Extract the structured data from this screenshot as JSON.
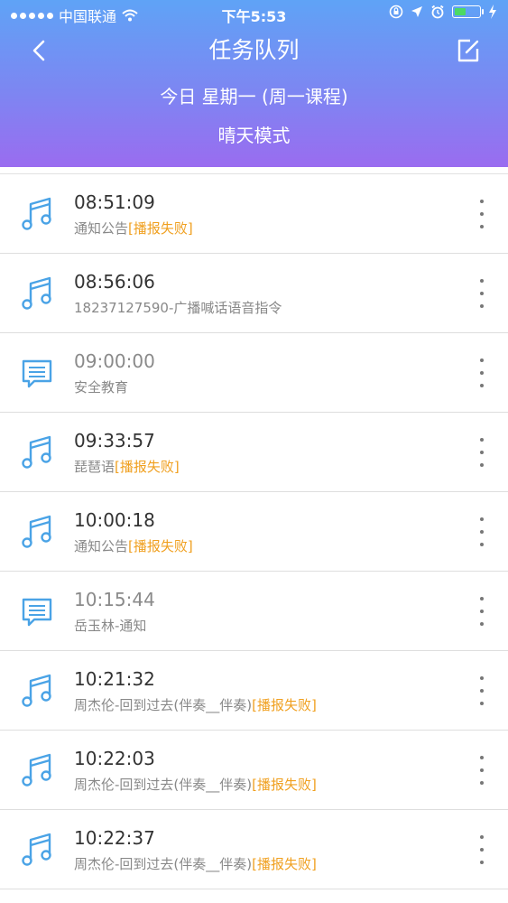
{
  "status_bar": {
    "carrier": "中国联通",
    "time": "下午5:53"
  },
  "header": {
    "title": "任务队列",
    "subtitle_day": "今日 星期一 (周一课程)",
    "subtitle_mode": "晴天模式"
  },
  "colors": {
    "accent_status": "#f0a020",
    "icon_blue": "#4aa3e6"
  },
  "tasks": [
    {
      "time": "08:51:09",
      "desc": "通知公告",
      "status": "[播报失败]",
      "icon": "music-note-icon",
      "dim": false
    },
    {
      "time": "08:56:06",
      "desc": "18237127590-广播喊话语音指令",
      "status": "",
      "icon": "music-note-icon",
      "dim": false
    },
    {
      "time": "09:00:00",
      "desc": "安全教育",
      "status": "",
      "icon": "message-icon",
      "dim": true
    },
    {
      "time": "09:33:57",
      "desc": "琵琶语",
      "status": "[播报失败]",
      "icon": "music-note-icon",
      "dim": false
    },
    {
      "time": "10:00:18",
      "desc": "通知公告",
      "status": "[播报失败]",
      "icon": "music-note-icon",
      "dim": false
    },
    {
      "time": "10:15:44",
      "desc": "岳玉林-通知",
      "status": "",
      "icon": "message-icon",
      "dim": true
    },
    {
      "time": "10:21:32",
      "desc": "周杰伦-回到过去(伴奏__伴奏)",
      "status": "[播报失败]",
      "icon": "music-note-icon",
      "dim": false
    },
    {
      "time": "10:22:03",
      "desc": "周杰伦-回到过去(伴奏__伴奏)",
      "status": "[播报失败]",
      "icon": "music-note-icon",
      "dim": false
    },
    {
      "time": "10:22:37",
      "desc": "周杰伦-回到过去(伴奏__伴奏)",
      "status": "[播报失败]",
      "icon": "music-note-icon",
      "dim": false
    }
  ]
}
